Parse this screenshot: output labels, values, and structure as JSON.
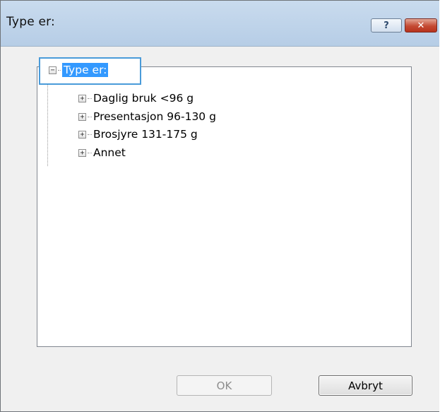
{
  "window": {
    "title": "Type er:"
  },
  "titlebar": {
    "help_label": "?",
    "close_label": "✕"
  },
  "tree": {
    "root": {
      "expander": "−",
      "label": "Type er:"
    },
    "items": [
      {
        "expander": "+",
        "label": "Daglig bruk <96 g"
      },
      {
        "expander": "+",
        "label": "Presentasjon 96-130 g"
      },
      {
        "expander": "+",
        "label": "Brosjyre 131-175 g"
      },
      {
        "expander": "+",
        "label": "Annet"
      }
    ]
  },
  "buttons": {
    "ok_label": "OK",
    "ok_enabled": false,
    "cancel_label": "Avbryt"
  },
  "colors": {
    "selection": "#3399ff",
    "focus_frame": "#4a9bd9",
    "close_button": "#c44a33"
  }
}
